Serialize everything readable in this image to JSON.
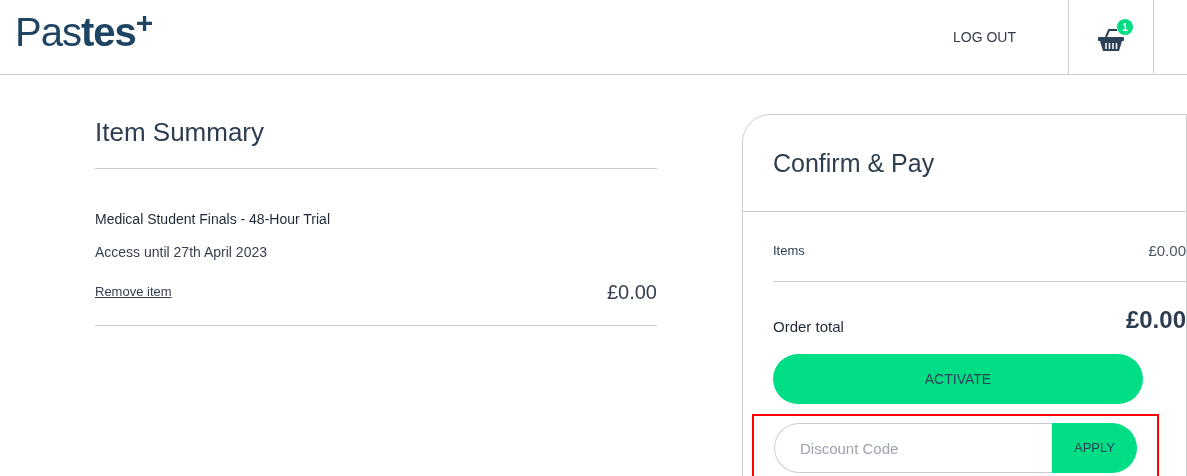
{
  "header": {
    "logo": {
      "light": "Pas",
      "bold": "tes",
      "mark": "+"
    },
    "logout": "LOG OUT",
    "cart_count": "1"
  },
  "summary": {
    "title": "Item Summary",
    "item_name": "Medical Student Finals - 48-Hour Trial",
    "access": "Access until 27th April 2023",
    "remove": "Remove item",
    "price": "£0.00"
  },
  "checkout": {
    "title": "Confirm & Pay",
    "items_label": "Items",
    "items_value": "£0.00",
    "total_label": "Order total",
    "total_value": "£0.00",
    "activate": "ACTIVATE",
    "discount_placeholder": "Discount Code",
    "apply": "APPLY",
    "highlighted": true
  }
}
